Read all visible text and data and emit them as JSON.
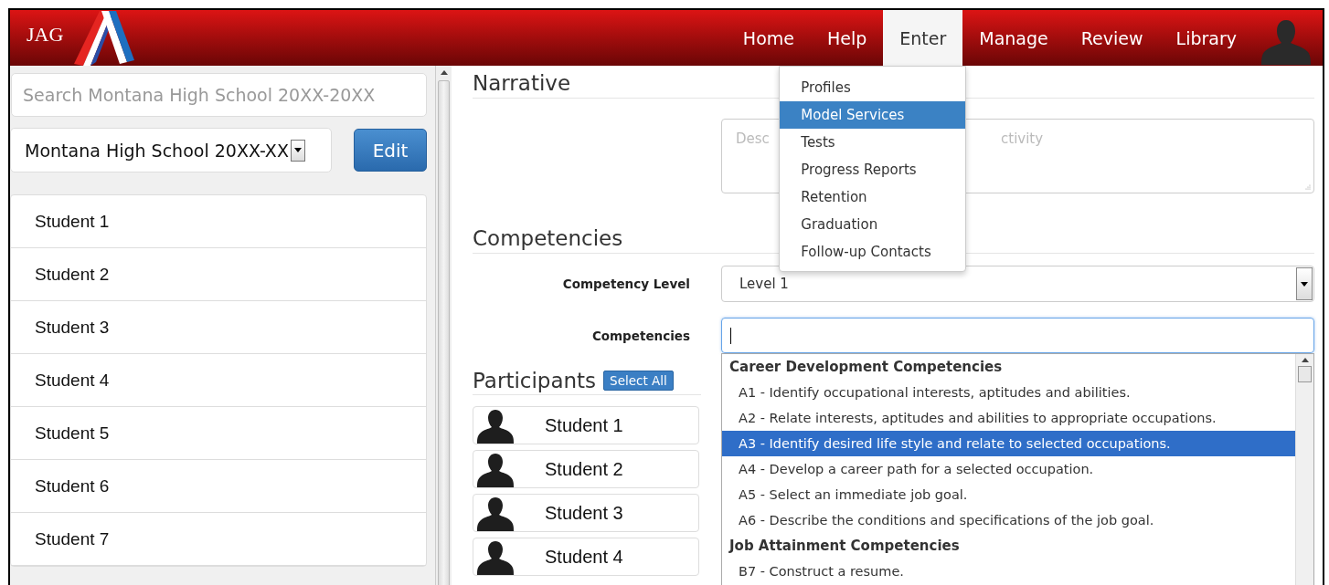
{
  "header": {
    "logo_text": "JAG",
    "nav": [
      {
        "label": "Home",
        "selected": false
      },
      {
        "label": "Help",
        "selected": false
      },
      {
        "label": "Enter",
        "selected": true,
        "menu": [
          {
            "label": "Profiles",
            "selected": false
          },
          {
            "label": "Model Services",
            "selected": true
          },
          {
            "label": "Tests",
            "selected": false
          },
          {
            "label": "Progress Reports",
            "selected": false
          },
          {
            "label": "Retention",
            "selected": false
          },
          {
            "label": "Graduation",
            "selected": false
          },
          {
            "label": "Follow-up Contacts",
            "selected": false
          }
        ]
      },
      {
        "label": "Manage",
        "selected": false
      },
      {
        "label": "Review",
        "selected": false
      },
      {
        "label": "Library",
        "selected": false
      }
    ]
  },
  "sidebar": {
    "search": {
      "placeholder": "Search Montana High School 20XX-20XX"
    },
    "school_select": {
      "value": "Montana High School 20XX-XX"
    },
    "edit_button": "Edit",
    "students": [
      {
        "label": "Student 1"
      },
      {
        "label": "Student 2"
      },
      {
        "label": "Student 3"
      },
      {
        "label": "Student 4"
      },
      {
        "label": "Student 5"
      },
      {
        "label": "Student 6"
      },
      {
        "label": "Student 7"
      }
    ]
  },
  "narrative": {
    "heading": "Narrative",
    "textarea_placeholder_parts": [
      "Desc",
      "ctivity"
    ]
  },
  "competencies": {
    "heading": "Competencies",
    "fields": [
      {
        "kind": "select",
        "label": "Competency Level",
        "value": "Level 1"
      },
      {
        "kind": "input",
        "label": "Competencies",
        "focused": true
      }
    ],
    "options": [
      {
        "kind": "group",
        "label": "Career Development Competencies"
      },
      {
        "kind": "option",
        "label": "A1 - Identify occupational interests, aptitudes and abilities.",
        "selected": false
      },
      {
        "kind": "option",
        "label": "A2 - Relate interests, aptitudes and abilities to appropriate occupations.",
        "selected": false
      },
      {
        "kind": "option",
        "label": "A3 - Identify desired life style and relate to selected occupations.",
        "selected": true
      },
      {
        "kind": "option",
        "label": "A4 - Develop a career path for a selected occupation.",
        "selected": false
      },
      {
        "kind": "option",
        "label": "A5 - Select an immediate job goal.",
        "selected": false
      },
      {
        "kind": "option",
        "label": "A6 - Describe the conditions and specifications of the job goal.",
        "selected": false
      },
      {
        "kind": "group",
        "label": "Job Attainment Competencies"
      },
      {
        "kind": "option",
        "label": "B7 - Construct a resume.",
        "selected": false
      }
    ]
  },
  "participants": {
    "heading": "Participants",
    "select_all": "Select All",
    "students": [
      {
        "label": "Student 1"
      },
      {
        "label": "Student 2"
      },
      {
        "label": "Student 3"
      },
      {
        "label": "Student 4"
      }
    ]
  }
}
